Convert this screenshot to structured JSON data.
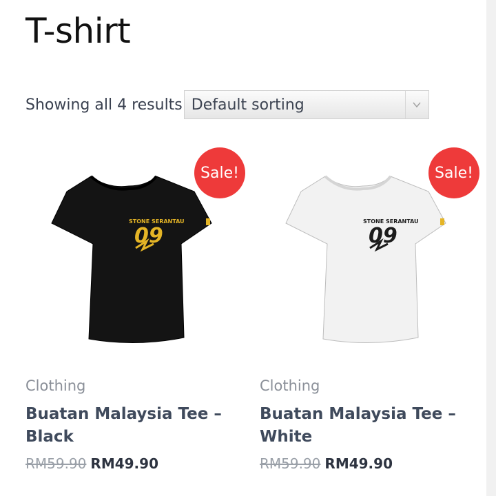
{
  "page": {
    "title": "T-shirt"
  },
  "toolbar": {
    "result_count": "Showing all 4 results",
    "sorting": {
      "selected": "Default sorting",
      "icon": "chevron-down-icon"
    }
  },
  "products": [
    {
      "sale_badge": "Sale!",
      "category": "Clothing",
      "name": "Buatan Malaysia Tee – Black",
      "regular_price": "RM59.90",
      "sale_price": "RM49.90",
      "shirt_color": "#141414",
      "print_color": "#e5b526"
    },
    {
      "sale_badge": "Sale!",
      "category": "Clothing",
      "name": "Buatan Malaysia Tee – White",
      "regular_price": "RM59.90",
      "sale_price": "RM49.90",
      "shirt_color": "#f2f2f2",
      "print_color": "#1c1c1c"
    }
  ],
  "colors": {
    "sale": "#ee3a3a",
    "product_name": "#3f4a5c"
  }
}
